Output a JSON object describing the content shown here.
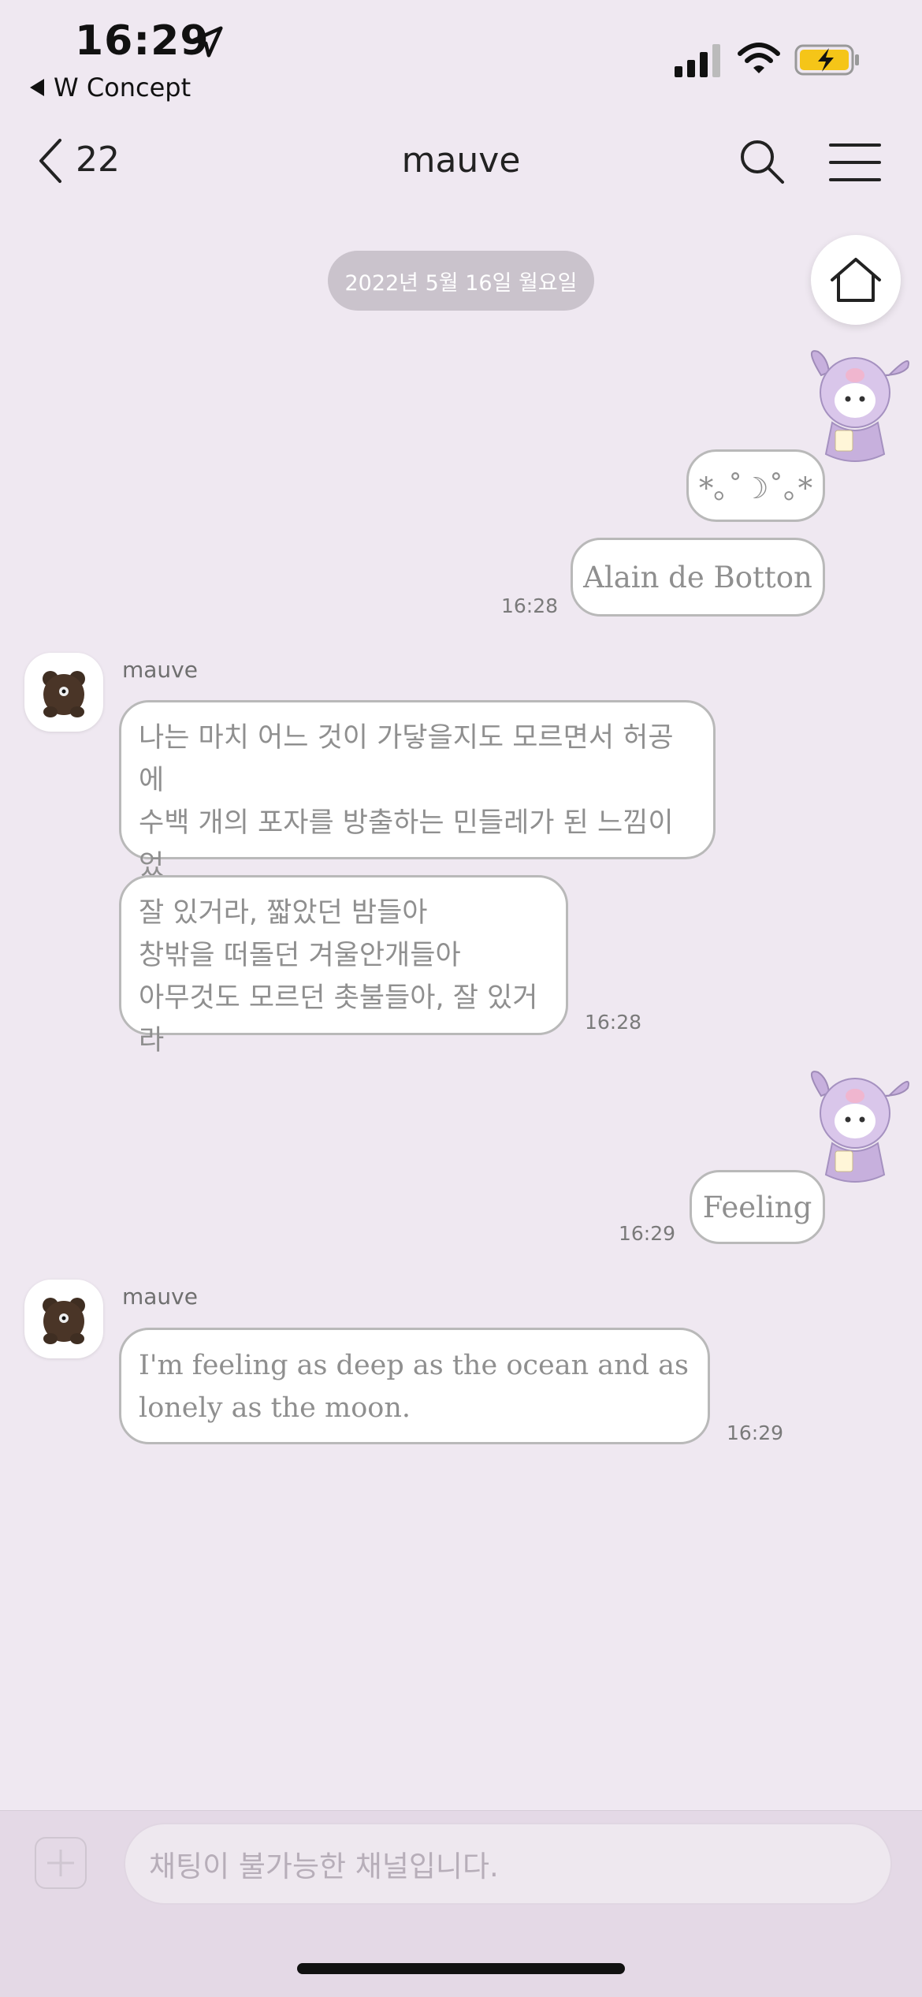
{
  "status_bar": {
    "time": "16:29",
    "back_app": "W Concept"
  },
  "header": {
    "back_count": "22",
    "title": "mauve"
  },
  "date_separator": "2022년 5월 16일 월요일",
  "messages": [
    {
      "side": "out",
      "kind": "sticker",
      "sticker": "kuromi-sticker"
    },
    {
      "side": "out",
      "text": "*｡˚☽˚｡*"
    },
    {
      "side": "out",
      "text": "Alain de Botton",
      "time": "16:28"
    },
    {
      "side": "in",
      "sender": "mauve",
      "text": "나는 마치 어느 것이 가닿을지도 모르면서 허공에\n수백 개의 포자를 방출하는 민들레가 된 느낌이었\n다."
    },
    {
      "side": "in",
      "text": "잘 있거라, 짧았던 밤들아\n창밖을 떠돌던 겨울안개들아\n아무것도 모르던 촛불들아, 잘 있거라",
      "time": "16:28"
    },
    {
      "side": "out",
      "kind": "sticker",
      "sticker": "kuromi-sticker"
    },
    {
      "side": "out",
      "text": "Feeling",
      "time": "16:29"
    },
    {
      "side": "in",
      "sender": "mauve",
      "text": "I'm feeling as deep as the ocean and as\nlonely as the moon.",
      "time": "16:29"
    }
  ],
  "input": {
    "placeholder": "채팅이 불가능한 채널입니다."
  },
  "colors": {
    "background": "#efe8f1",
    "bubble_border": "#b9b9b9",
    "date_pill": "#cac3cc",
    "bottom_bar": "#e4d9e6"
  }
}
